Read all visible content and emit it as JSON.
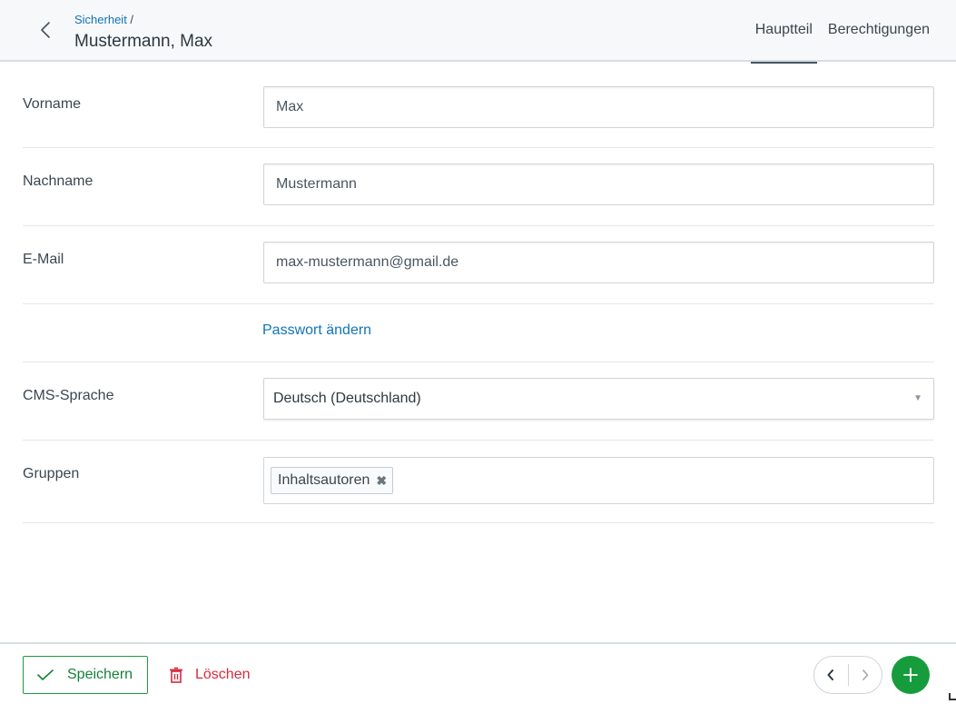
{
  "header": {
    "breadcrumb_link": "Sicherheit",
    "breadcrumb_separator": " /",
    "title": "Mustermann, Max",
    "tabs": [
      {
        "label": "Hauptteil",
        "active": true
      },
      {
        "label": "Berechtigungen",
        "active": false
      }
    ]
  },
  "form": {
    "first_name": {
      "label": "Vorname",
      "value": "Max"
    },
    "last_name": {
      "label": "Nachname",
      "value": "Mustermann"
    },
    "email": {
      "label": "E-Mail",
      "value": "max-mustermann@gmail.de"
    },
    "password_link": "Passwort ändern",
    "language": {
      "label": "CMS-Sprache",
      "value": "Deutsch (Deutschland)"
    },
    "groups": {
      "label": "Gruppen",
      "tags": [
        "Inhaltsautoren"
      ],
      "remove_glyph": "✖"
    }
  },
  "footer": {
    "save_label": "Speichern",
    "delete_label": "Löschen"
  },
  "colors": {
    "link": "#1174b8",
    "success": "#169c3c",
    "danger": "#d9293b"
  },
  "icons": [
    "back-chevron-icon",
    "check-icon",
    "trash-icon",
    "chevron-left-icon",
    "chevron-right-icon",
    "plus-icon",
    "dropdown-arrow-icon",
    "tag-remove-icon"
  ]
}
